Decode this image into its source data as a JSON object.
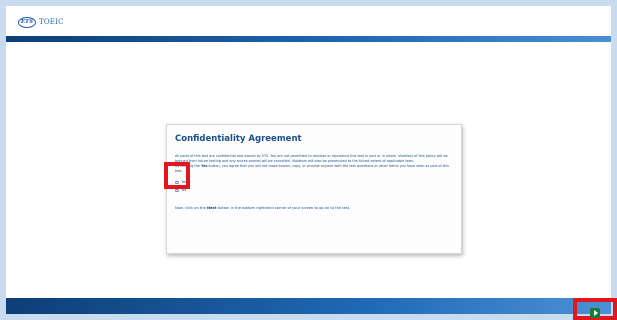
{
  "header": {
    "logo_ets": "ETS",
    "logo_toeic": "TOEIC"
  },
  "dialog": {
    "title": "Confidentiality Agreement",
    "paragraph1": "All parts of this test are confidential and owned by ETS. You are not permitted to disclose or reproduce this test in part or in whole. Violators of this policy will be banned from future testing and any scores earned will be cancelled. Violators will also be prosecuted to the fullest extent of applicable laws.",
    "paragraph2_prefix": "By clicking the",
    "paragraph2_bold": "Yes",
    "paragraph2_suffix": "button, you agree that you will not make known, copy, or provide anyone with the test questions or other items you have seen as part of this test.",
    "options": [
      {
        "label": "Yes",
        "selected": false
      },
      {
        "label": "No",
        "selected": false
      }
    ],
    "next_prefix": "Now, click on the",
    "next_bold": "Next",
    "next_suffix": "button in the bottom righthand corner of your screen to go on to the test."
  },
  "footer": {
    "next_icon": "next-arrow-icon"
  },
  "colors": {
    "accent": "#1b4f8a",
    "highlight": "#e3151d",
    "next_button": "#1a7a36"
  }
}
